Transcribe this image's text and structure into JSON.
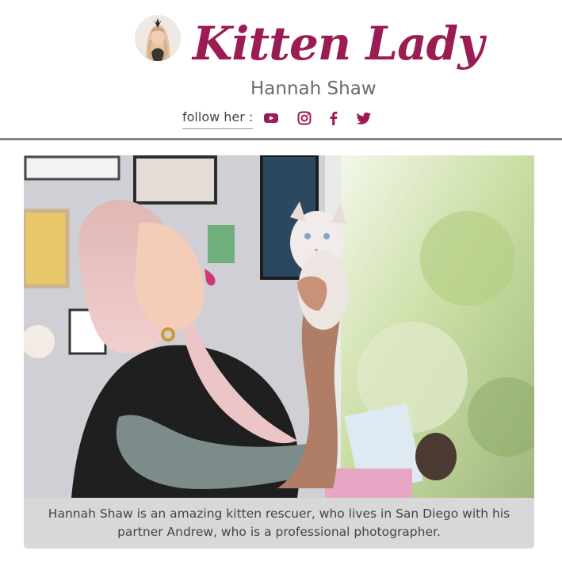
{
  "header": {
    "title": "Kitten Lady",
    "subtitle": "Hannah Shaw",
    "follow_label": "follow her :",
    "social": [
      {
        "name": "youtube-icon"
      },
      {
        "name": "instagram-icon"
      },
      {
        "name": "facebook-icon"
      },
      {
        "name": "twitter-icon"
      }
    ]
  },
  "photo": {
    "caption": "Hannah Shaw is an amazing kitten rescuer, who lives in San Diego with his partner Andrew, who is a professional photographer."
  },
  "colors": {
    "brand": "#9b1b55",
    "text": "#444444",
    "subtitle": "#6b6b6b",
    "divider": "#858585",
    "caption_bg": "#d8d8d8"
  }
}
